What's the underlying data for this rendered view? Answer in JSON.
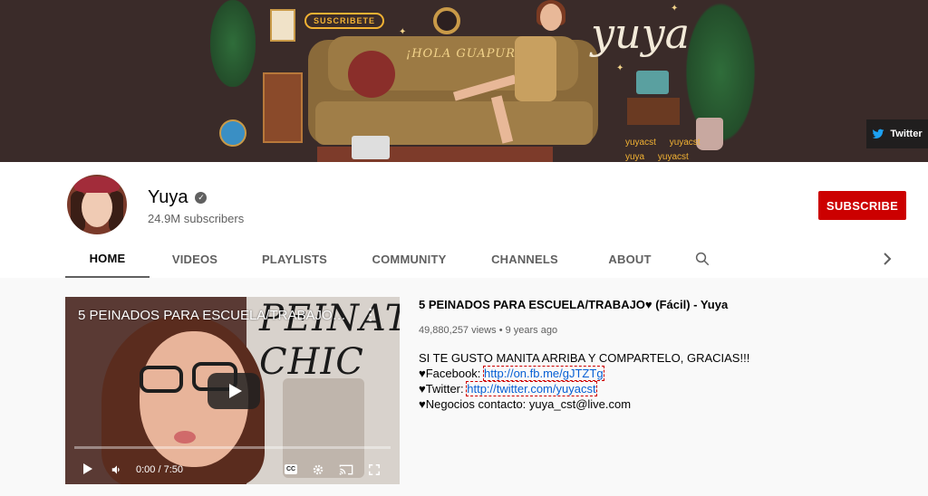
{
  "banner": {
    "sign_text": "SUSCRIBETE",
    "hola_text": "¡HOLA GUAPURAS!",
    "script_name": "yuya",
    "socials": [
      "yuyacst",
      "yuyacst",
      "yuya",
      "yuyacst"
    ],
    "twitter_label": "Twitter"
  },
  "channel": {
    "name": "Yuya",
    "verified_glyph": "✓",
    "subscribers": "24.9M subscribers",
    "subscribe_label": "SUBSCRIBE"
  },
  "tabs": [
    {
      "label": "HOME",
      "active": true
    },
    {
      "label": "VIDEOS",
      "active": false
    },
    {
      "label": "PLAYLISTS",
      "active": false
    },
    {
      "label": "COMMUNITY",
      "active": false
    },
    {
      "label": "CHANNELS",
      "active": false
    },
    {
      "label": "ABOUT",
      "active": false
    }
  ],
  "player": {
    "overlay_title": "5 PEINADOS PARA ESCUELA/TRABAJO♥ ...",
    "thumbnail_text": "PEINATE CHIC",
    "time": "0:00 / 7:50",
    "cc_label": "CC",
    "progress": 0
  },
  "video": {
    "title": "5 PEINADOS PARA ESCUELA/TRABAJO♥ (Fácil) - Yuya",
    "views": "49,880,257 views",
    "age": "9 years ago",
    "desc_line1": "SI TE GUSTO MANITA ARRIBA Y COMPARTELO, GRACIAS!!!",
    "fb_prefix": "♥Facebook: ",
    "fb_link": "http://on.fb.me/gJTZTg",
    "tw_prefix": "♥Twitter: ",
    "tw_link": "http://twitter.com/yuyacst",
    "business": "♥Negocios contacto: yuya_cst@live.com"
  },
  "colors": {
    "subscribe": "#cc0000",
    "link": "#065fd4",
    "banner_bg": "#3a2b29"
  }
}
